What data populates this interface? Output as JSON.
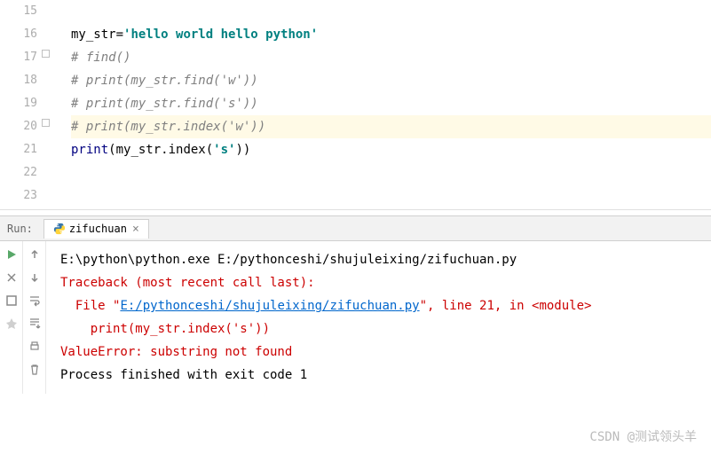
{
  "gutter": [
    "15",
    "16",
    "17",
    "18",
    "19",
    "20",
    "21",
    "22",
    "23"
  ],
  "code": {
    "line16_var": "my_str",
    "line16_eq": "=",
    "line16_str": "'hello world hello python'",
    "line17": "# find()",
    "line18": "# print(my_str.find('w'))",
    "line19": "# print(my_str.find('s'))",
    "line20": "# print(my_str.index('w'))",
    "line21_kw": "print",
    "line21_mid": "(my_str.index(",
    "line21_arg": "'s'",
    "line21_end": "))"
  },
  "run": {
    "label": "Run:",
    "tab": "zifuchuan",
    "tab_close": "×"
  },
  "console": {
    "l1": "E:\\python\\python.exe E:/pythonceshi/shujuleixing/zifuchuan.py",
    "l2": "Traceback (most recent call last):",
    "l3a": "  File \"",
    "l3b": "E:/pythonceshi/shujuleixing/zifuchuan.py",
    "l3c": "\", line 21, in <module>",
    "l4": "    print(my_str.index('s'))",
    "l5": "ValueError: substring not found",
    "l6": "",
    "l7": "Process finished with exit code 1"
  },
  "watermark": "CSDN @测试领头羊"
}
